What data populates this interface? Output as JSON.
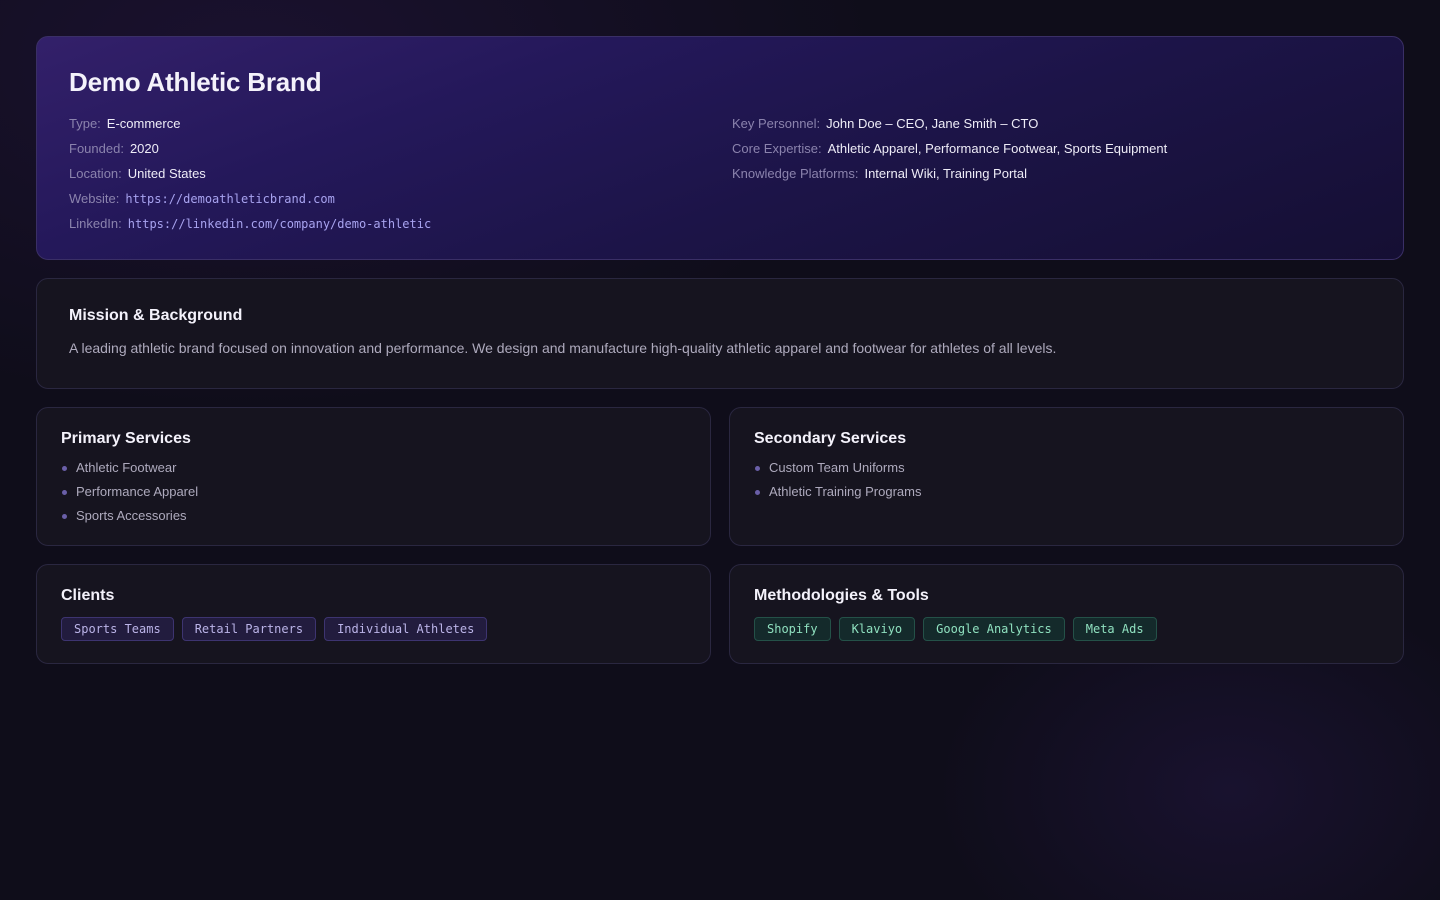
{
  "company": {
    "name": "Demo Athletic Brand",
    "details_left": [
      {
        "label": "Type:",
        "value": "E-commerce"
      },
      {
        "label": "Founded:",
        "value": "2020"
      },
      {
        "label": "Location:",
        "value": "United States"
      },
      {
        "label": "Website:",
        "value": "https://demoathleticbrand.com"
      },
      {
        "label": "LinkedIn:",
        "value": "https://linkedin.com/company/demo-athletic"
      }
    ],
    "details_right": [
      {
        "label": "Key Personnel:",
        "value": "John Doe – CEO, Jane Smith – CTO"
      },
      {
        "label": "Core Expertise:",
        "value": "Athletic Apparel, Performance Footwear, Sports Equipment"
      },
      {
        "label": "Knowledge Platforms:",
        "value": "Internal Wiki, Training Portal"
      }
    ]
  },
  "mission": {
    "title": "Mission & Background",
    "text": "A leading athletic brand focused on innovation and performance. We design and manufacture high-quality athletic apparel and footwear for athletes of all levels."
  },
  "primary_services": {
    "title": "Primary Services",
    "items": [
      "Athletic Footwear",
      "Performance Apparel",
      "Sports Accessories"
    ]
  },
  "secondary_services": {
    "title": "Secondary Services",
    "items": [
      "Custom Team Uniforms",
      "Athletic Training Programs"
    ]
  },
  "clients": {
    "title": "Clients",
    "tags": [
      "Sports Teams",
      "Retail Partners",
      "Individual Athletes"
    ]
  },
  "tools": {
    "title": "Methodologies & Tools",
    "tags": [
      "Shopify",
      "Klaviyo",
      "Google Analytics",
      "Meta Ads"
    ]
  },
  "colors": {
    "background": "#0f0d1a",
    "card": "#16141f",
    "hero_accent": "#33206a",
    "link": "#a8a3f0",
    "client_tag": "#bbb4e8",
    "tool_tag": "#8fe0bf"
  }
}
